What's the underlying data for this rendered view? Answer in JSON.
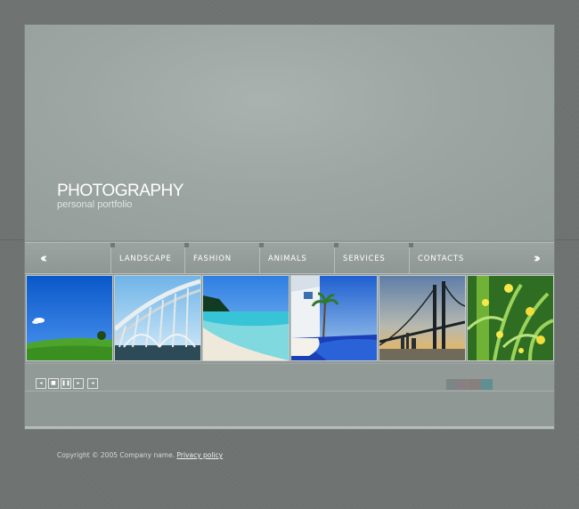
{
  "header": {
    "title": "PHOTOGRAPHY",
    "subtitle": "personal portfolio"
  },
  "nav": {
    "prev_icon": "double-chevron-left-icon",
    "next_icon": "double-chevron-right-icon",
    "items": [
      {
        "label": "LANDSCAPE"
      },
      {
        "label": "FASHION"
      },
      {
        "label": "ANIMALS"
      },
      {
        "label": "SERVICES"
      },
      {
        "label": "CONTACTS"
      }
    ]
  },
  "gallery": {
    "thumbnails": [
      {
        "subject": "green field under blue sky"
      },
      {
        "subject": "steel arch bridge"
      },
      {
        "subject": "tropical beach"
      },
      {
        "subject": "resort pool with palm"
      },
      {
        "subject": "suspension bridge at sunset"
      },
      {
        "subject": "green plants with yellow flowers"
      }
    ]
  },
  "player": {
    "controls": [
      "rewind-icon",
      "stop-icon",
      "pause-icon",
      "forward-icon",
      "sound-icon"
    ]
  },
  "swatches": {
    "colors": [
      "#7c8485",
      "#8a7f82",
      "#85807c",
      "#5f8f92"
    ]
  },
  "footer": {
    "copyright": "Copyright © 2005 Company name. ",
    "privacy_link": "Privacy policy"
  },
  "colors": {
    "background": "#6e7371",
    "panel": "#8f9895",
    "header": "#9da6a3",
    "text": "#ffffff"
  }
}
